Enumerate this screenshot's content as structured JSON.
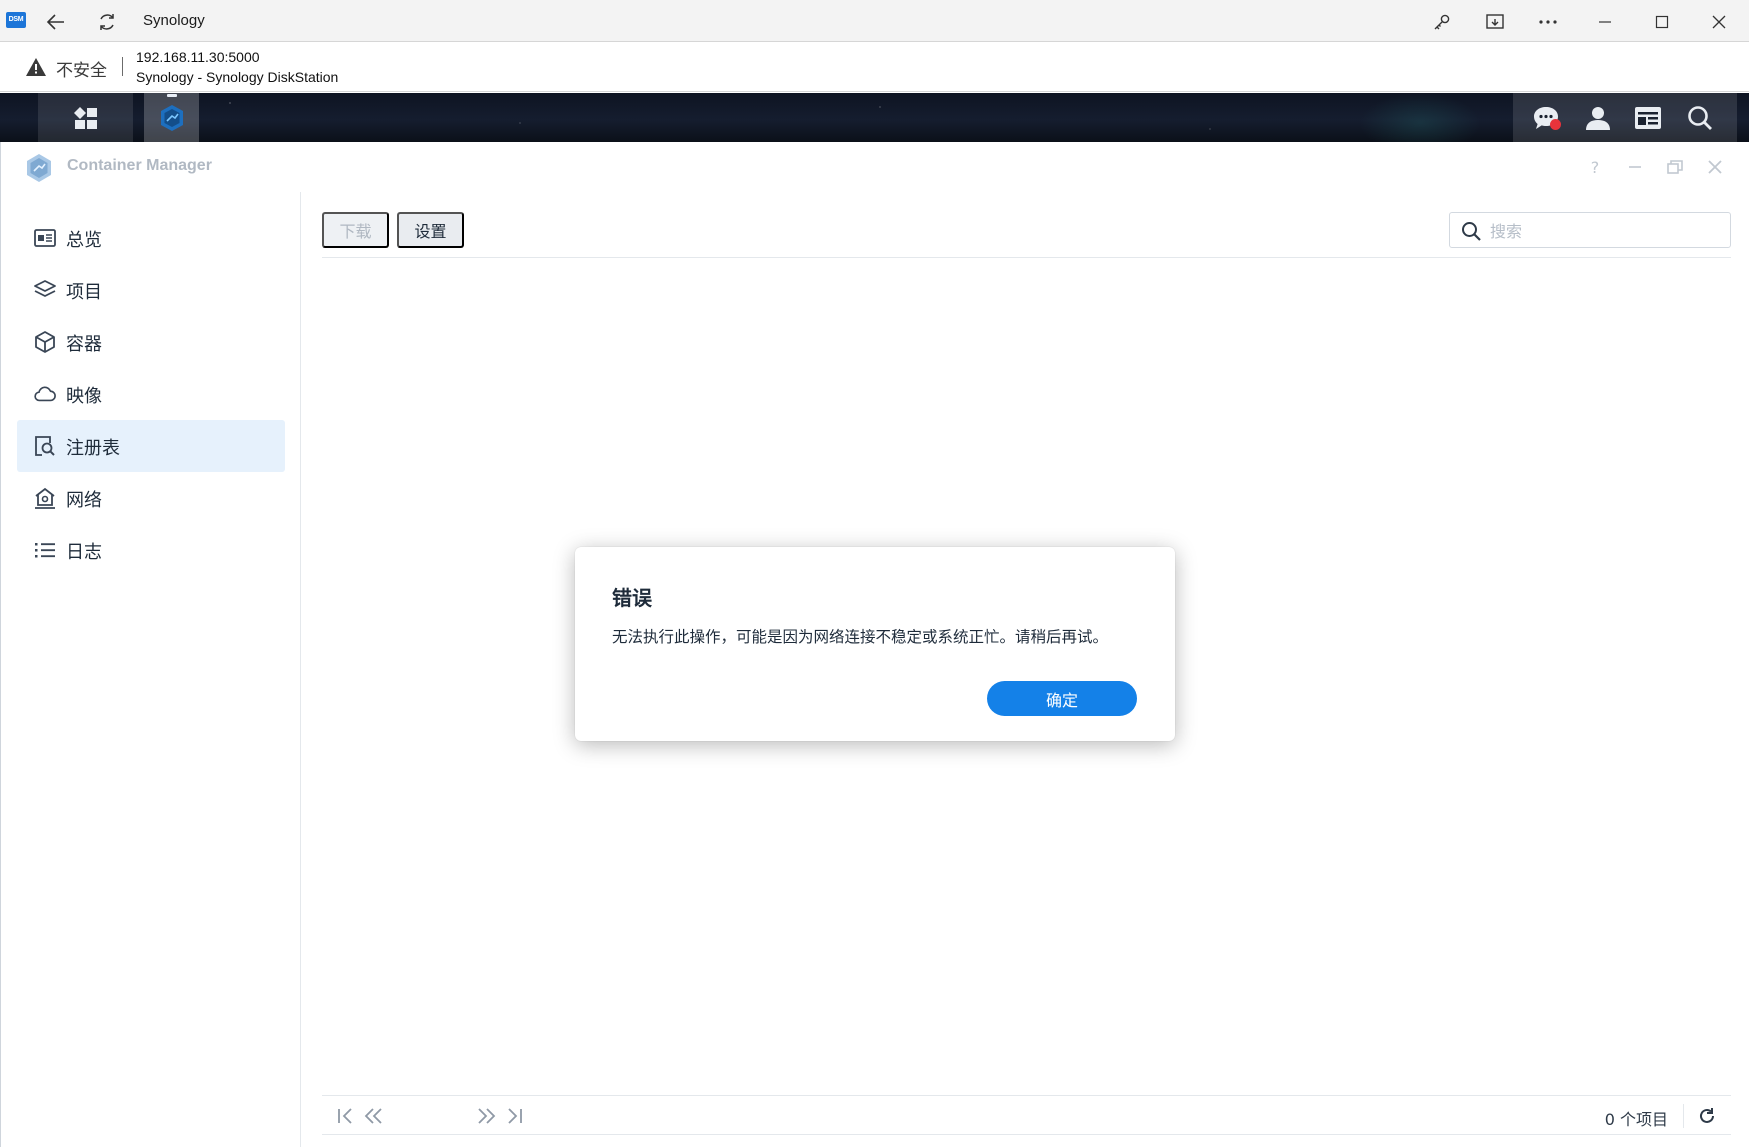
{
  "browser": {
    "logo_text": "DSM",
    "title": "Synology",
    "security_label": "不安全",
    "url": "192.168.11.30:5000",
    "page_title": "Synology - Synology DiskStation"
  },
  "app": {
    "title": "Container Manager",
    "help_label": "?"
  },
  "sidebar": {
    "items": [
      {
        "label": "总览",
        "icon": "overview-icon"
      },
      {
        "label": "项目",
        "icon": "layers-icon"
      },
      {
        "label": "容器",
        "icon": "cube-icon"
      },
      {
        "label": "映像",
        "icon": "cloud-icon"
      },
      {
        "label": "注册表",
        "icon": "registry-search-icon",
        "active": true
      },
      {
        "label": "网络",
        "icon": "network-home-icon"
      },
      {
        "label": "日志",
        "icon": "list-icon"
      }
    ]
  },
  "toolbar": {
    "download_label": "下载",
    "settings_label": "设置",
    "search_placeholder": "搜索"
  },
  "footer": {
    "item_count": "0 个项目"
  },
  "dialog": {
    "title": "错误",
    "message": "无法执行此操作，可能是因为网络连接不稳定或系统正忙。请稍后再试。",
    "ok_label": "确定"
  },
  "colors": {
    "accent": "#1481e8",
    "active_nav_bg": "#e6f1fc",
    "notification": "#e8333b"
  }
}
